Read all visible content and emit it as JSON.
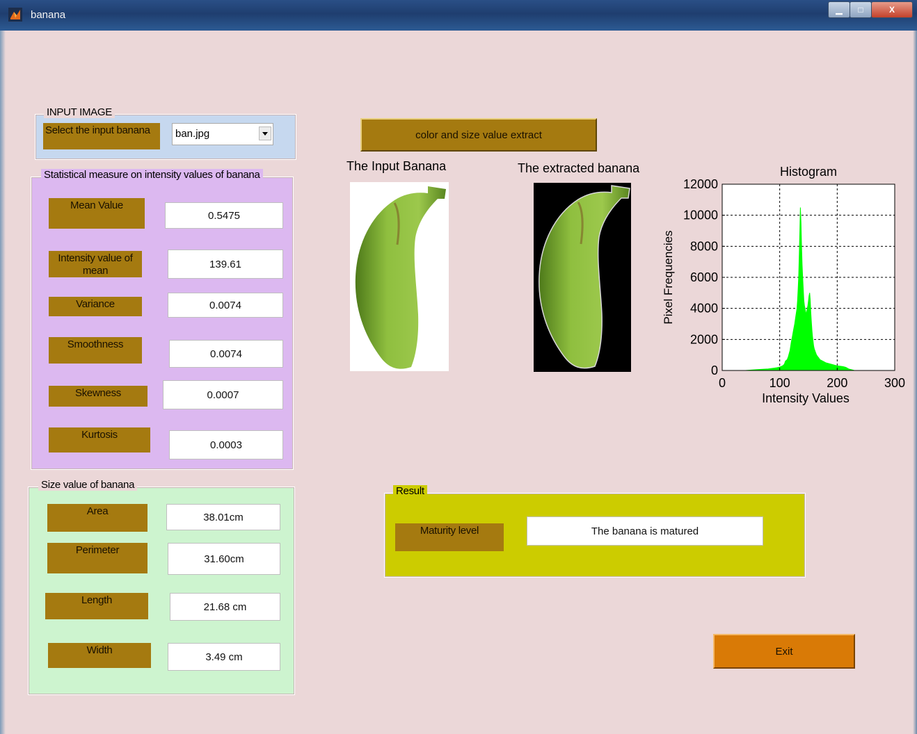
{
  "window": {
    "title": "banana",
    "controls": {
      "minimize": "▁",
      "maximize": "□",
      "close": "X"
    }
  },
  "input_panel": {
    "title": "INPUT IMAGE",
    "select_label": "Select the input banana",
    "selected_file": "ban.jpg"
  },
  "extract_button": "color and size value extract",
  "stats_panel": {
    "title": "Statistical measure on intensity values of banana",
    "items": [
      {
        "label": "Mean Value",
        "value": "0.5475"
      },
      {
        "label": "Intensity value of mean",
        "value": "139.61"
      },
      {
        "label": "Variance",
        "value": "0.0074"
      },
      {
        "label": "Smoothness",
        "value": "0.0074"
      },
      {
        "label": "Skewness",
        "value": "0.0007"
      },
      {
        "label": "Kurtosis",
        "value": "0.0003"
      }
    ]
  },
  "size_panel": {
    "title": "Size value of banana",
    "items": [
      {
        "label": "Area",
        "value": "38.01cm"
      },
      {
        "label": "Perimeter",
        "value": "31.60cm"
      },
      {
        "label": "Length",
        "value": "21.68 cm"
      },
      {
        "label": "Width",
        "value": "3.49 cm"
      }
    ]
  },
  "images": {
    "input_title": "The Input Banana",
    "extracted_title": "The extracted banana"
  },
  "result_panel": {
    "title": "Result",
    "label": "Maturity level",
    "value": "The banana is matured"
  },
  "exit_button": "Exit",
  "colors": {
    "background": "#ebd7d8",
    "brown_label": "#a57a10",
    "input_panel": "#c6d8ef",
    "stats_panel": "#dcb8f0",
    "size_panel": "#cdf4cf",
    "result_panel": "#cccc00",
    "exit_button": "#d97a06",
    "histogram": "#00ff00"
  },
  "chart_data": {
    "type": "area",
    "title": "Histogram",
    "xlabel": "Intensity Values",
    "ylabel": "Pixel Frequencies",
    "xlim": [
      0,
      300
    ],
    "ylim": [
      0,
      12000
    ],
    "xticks": [
      0,
      100,
      200,
      300
    ],
    "yticks": [
      0,
      2000,
      4000,
      6000,
      8000,
      10000,
      12000
    ],
    "grid": true,
    "series": [
      {
        "x": [
          40,
          60,
          80,
          90,
          95,
          100,
          105,
          108,
          110,
          113,
          115,
          118,
          120,
          122,
          124,
          126,
          128,
          130,
          131,
          132,
          133,
          134,
          135,
          136,
          137,
          138,
          139,
          140,
          141,
          142,
          143,
          144,
          145,
          146,
          147,
          148,
          149,
          150,
          151,
          152,
          153,
          154,
          155,
          156,
          157,
          158,
          159,
          160,
          162,
          164,
          166,
          168,
          170,
          175,
          180,
          190,
          200,
          210,
          215,
          220,
          230
        ],
        "y": [
          0,
          60,
          100,
          150,
          180,
          220,
          300,
          400,
          600,
          700,
          900,
          1300,
          1800,
          2200,
          2600,
          3000,
          3500,
          4000,
          4500,
          5200,
          6000,
          7500,
          9000,
          10500,
          9500,
          8000,
          6800,
          6000,
          5200,
          4500,
          4200,
          4000,
          3800,
          3600,
          3800,
          4000,
          4200,
          4500,
          4800,
          5000,
          4600,
          3800,
          3200,
          2600,
          2200,
          1900,
          1600,
          1400,
          1200,
          1000,
          900,
          800,
          700,
          600,
          500,
          400,
          300,
          250,
          200,
          100,
          0
        ]
      }
    ]
  }
}
